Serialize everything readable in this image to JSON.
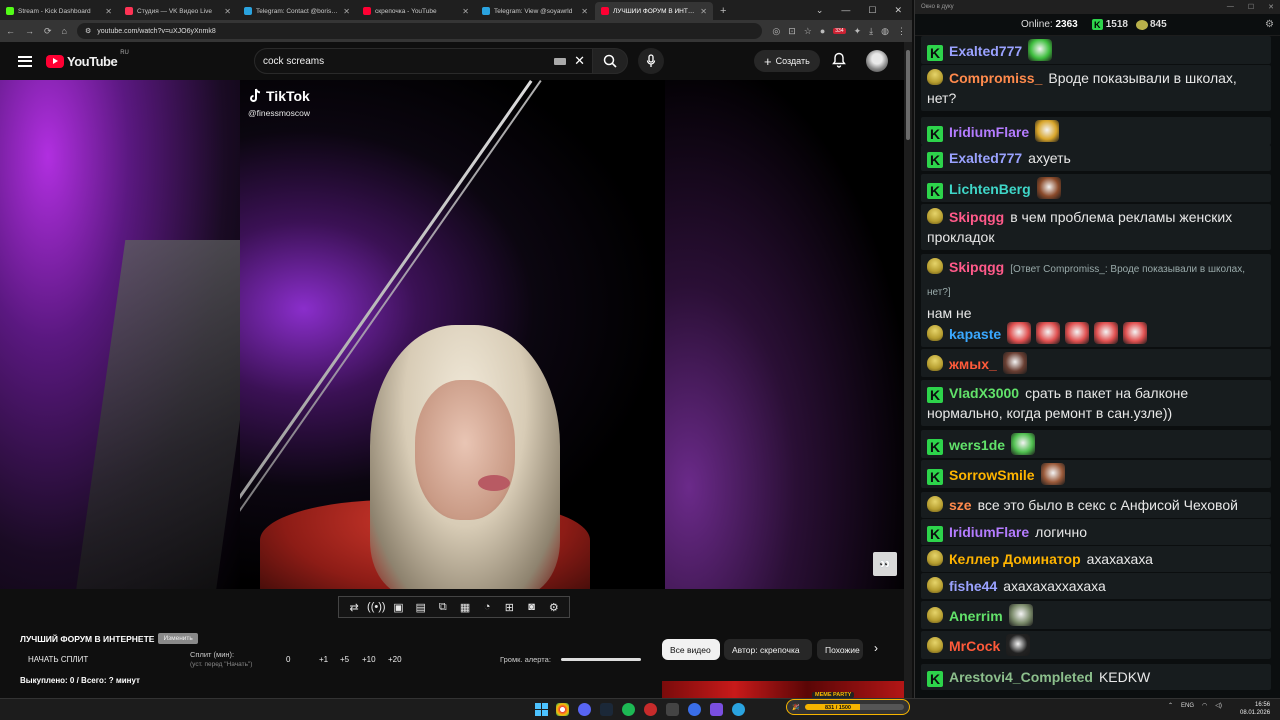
{
  "browser": {
    "tabs": [
      {
        "label": "Stream - Kick Dashboard",
        "color": "#53fc18"
      },
      {
        "label": "Студия — VK Видео Live",
        "color": "#ff3355"
      },
      {
        "label": "Telegram: Contact @boris_rofl",
        "color": "#2aa3df"
      },
      {
        "label": "скрепочка - YouTube",
        "color": "#ff0033"
      },
      {
        "label": "Telegram: View @soyawrld",
        "color": "#2aa3df"
      },
      {
        "label": "ЛУЧШИЙ ФОРУМ В ИНТЕРНЕТЕ",
        "color": "#ff0033"
      }
    ],
    "url": "youtube.com/watch?v=uXJO6yXnmk8",
    "ext_badge": "334"
  },
  "youtube": {
    "logo_text": "YouTube",
    "region": "RU",
    "search_value": "cock screams",
    "create_label": "Создать"
  },
  "video": {
    "overlay_brand": "TikTok",
    "overlay_handle": "@finessmoscow"
  },
  "below": {
    "forum_title": "ЛУЧШИЙ ФОРУМ В ИНТЕРНЕТЕ",
    "forum_button": "Изменить",
    "start_split": "НАЧАТЬ СПЛИТ",
    "split_label": "Сплит (мин):",
    "split_hint": "(уст. перед \"Начать\")",
    "split_values": [
      "0",
      "+1",
      "+5",
      "+10",
      "+20"
    ],
    "alert_label": "Громк. алерта:",
    "stats": "Выкуплено: 0 / Всего: ? минут",
    "chips": [
      "Все видео",
      "Автор: скрепочка",
      "Похожие"
    ]
  },
  "chat": {
    "window_title": "Окно в дуку",
    "online_label": "Online:",
    "online_count": "2363",
    "kick_count": "1518",
    "pepe_count": "845",
    "messages": [
      {
        "badge": "k",
        "nick": "Exalted777",
        "color": "#9aa2ff",
        "text": "",
        "emotes": [
          "#3fbf3f"
        ]
      },
      {
        "badge": "pepe",
        "nick": "Compromiss_",
        "color": "#ff8a4c",
        "text": "Вроде показывали в школах, нет?"
      },
      {
        "badge": "k",
        "nick": "IridiumFlare",
        "color": "#b47cff",
        "text": "",
        "emotes": [
          "#d8a52a"
        ]
      },
      {
        "badge": "k",
        "nick": "Exalted777",
        "color": "#9aa2ff",
        "text": "ахуеть"
      },
      {
        "badge": "k",
        "nick": "LichtenBerg",
        "color": "#3fd6c8",
        "text": "",
        "emotes": [
          "#8a4a2a"
        ]
      },
      {
        "badge": "pepe",
        "nick": "Skipqgg",
        "color": "#ff5a8a",
        "text": "в чем проблема рекламы женских прокладок"
      },
      {
        "badge": "pepe",
        "nick": "Skipqgg",
        "color": "#ff5a8a",
        "reply": "[Ответ Compromiss_: Вроде показывали в школах, нет?]",
        "text": "нам не"
      },
      {
        "badge": "pepe",
        "nick": "kapaste",
        "color": "#3aa8ff",
        "text": "",
        "emotes": [
          "#e05050",
          "#e05050",
          "#e05050",
          "#e05050",
          "#e05050"
        ]
      },
      {
        "badge": "pepe",
        "nick": "жмых_",
        "color": "#ff5a3a",
        "text": "",
        "emotes": [
          "#6a3f33"
        ]
      },
      {
        "badge": "k",
        "nick": "VladX3000",
        "color": "#62e26a",
        "text": "срать в пакет на балконе нормально, когда ремонт в сан.узле))"
      },
      {
        "badge": "k",
        "nick": "wers1de",
        "color": "#62e26a",
        "text": "",
        "emotes": [
          "#4fbf4f"
        ]
      },
      {
        "badge": "k",
        "nick": "SorrowSmile",
        "color": "#ffb400",
        "text": "",
        "emotes": [
          "#9a5a3a"
        ]
      },
      {
        "badge": "pepe",
        "nick": "sze",
        "color": "#ff8a4c",
        "text": "все это было в секс с Анфисой Чеховой"
      },
      {
        "badge": "k",
        "nick": "IridiumFlare",
        "color": "#b47cff",
        "text": "логично"
      },
      {
        "badge": "pepe",
        "nick": "Келлер Доминатор",
        "color": "#ffb400",
        "text": "ахахахаха"
      },
      {
        "badge": "pepe",
        "nick": "fishe44",
        "color": "#9aa2ff",
        "text": "ахахахаххахаха"
      },
      {
        "badge": "pepe",
        "nick": "Anerrim",
        "color": "#62e26a",
        "text": "",
        "emotes": [
          "#7a8a6a"
        ]
      },
      {
        "badge": "pepe",
        "nick": "MrCock",
        "color": "#ff5a3a",
        "text": "",
        "emotes": [
          "#222222"
        ]
      },
      {
        "badge": "k",
        "nick": "Arestovi4_Completed",
        "color": "#8cbf8c",
        "text": "KEDKW"
      }
    ]
  },
  "taskbar": {
    "party_title": "МЕМЕ PARTY",
    "party_progress": "831 / 1500",
    "party_fraction": 0.554,
    "lang": "ENG",
    "time": "16:56",
    "date": "08.01.2026"
  }
}
